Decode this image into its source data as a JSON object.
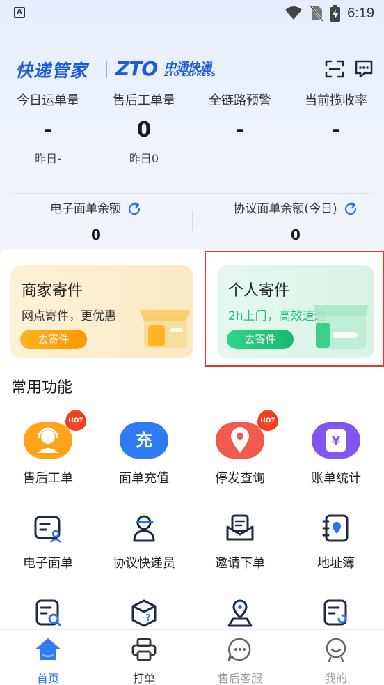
{
  "status_bar": {
    "time": "6:19",
    "app_icon_letter": "A"
  },
  "header": {
    "brand_name": "快递管家",
    "partner_mark": "ZTO",
    "partner_cn": "中通快递",
    "partner_en": "ZTO EXPRESS",
    "icons": [
      "scan-icon",
      "message-icon"
    ]
  },
  "stats": [
    {
      "label": "今日运单量",
      "value": "-",
      "sub": "昨日-"
    },
    {
      "label": "售后工单量",
      "value": "0",
      "sub": "昨日0"
    },
    {
      "label": "全链路预警",
      "value": "-",
      "sub": ""
    },
    {
      "label": "当前揽收率",
      "value": "-",
      "sub": ""
    }
  ],
  "balances": [
    {
      "label": "电子面单余额",
      "value": "0"
    },
    {
      "label": "协议面单余额(今日)",
      "value": "0"
    }
  ],
  "promos": {
    "merchant": {
      "title": "商家寄件",
      "subtitle": "网点寄件，更优惠",
      "button": "去寄件"
    },
    "personal": {
      "title": "个人寄件",
      "subtitle": "2h上门，高效速达",
      "button": "去寄件"
    }
  },
  "section_title": "常用功能",
  "functions": [
    {
      "label": "售后工单",
      "hot": "HOT",
      "icon": "service-agent-icon"
    },
    {
      "label": "面单充值",
      "icon_text": "充",
      "icon": "recharge-icon"
    },
    {
      "label": "停发查询",
      "hot": "HOT",
      "icon": "location-pin-icon"
    },
    {
      "label": "账单统计",
      "icon_text": "¥",
      "icon": "bill-icon"
    },
    {
      "label": "电子面单",
      "icon": "e-waybill-icon"
    },
    {
      "label": "协议快递员",
      "icon": "courier-icon"
    },
    {
      "label": "邀请下单",
      "icon": "invite-mail-icon"
    },
    {
      "label": "地址簿",
      "icon": "address-book-icon"
    }
  ],
  "nav": [
    {
      "label": "首页",
      "icon": "home-icon",
      "active": true
    },
    {
      "label": "打单",
      "icon": "printer-icon"
    },
    {
      "label": "售后客服",
      "icon": "chat-support-icon"
    },
    {
      "label": "我的",
      "icon": "profile-icon"
    }
  ],
  "colors": {
    "brand_blue": "#1d5bd8",
    "accent_blue": "#2f6ff0",
    "orange": "#ff9800",
    "green": "#19b870",
    "hot_red": "#f0381f"
  }
}
